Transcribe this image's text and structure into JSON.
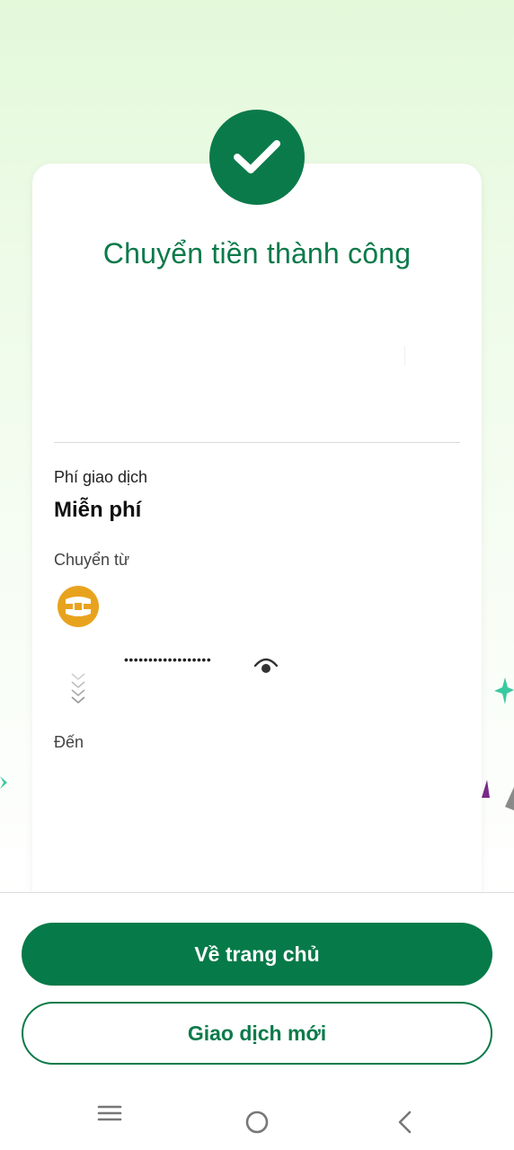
{
  "result": {
    "title": "Chuyển tiền thành công"
  },
  "details": {
    "fee_label": "Phí giao dịch",
    "fee_value": "Miễn phí",
    "from_label": "Chuyển từ",
    "account_masked": "••••••••••••••••••",
    "to_label": "Đến"
  },
  "actions": {
    "home_label": "Về trang chủ",
    "new_transaction_label": "Giao dịch mới"
  },
  "icons": {
    "success": "check-icon",
    "bank": "bank-logo",
    "visibility": "eye-icon",
    "direction": "chevrons-down-icon",
    "nav_menu": "menu-icon",
    "nav_home": "home-circle-icon",
    "nav_back": "back-icon"
  },
  "colors": {
    "brand_green": "#0b7a4a",
    "bank_orange": "#e8a31e"
  }
}
